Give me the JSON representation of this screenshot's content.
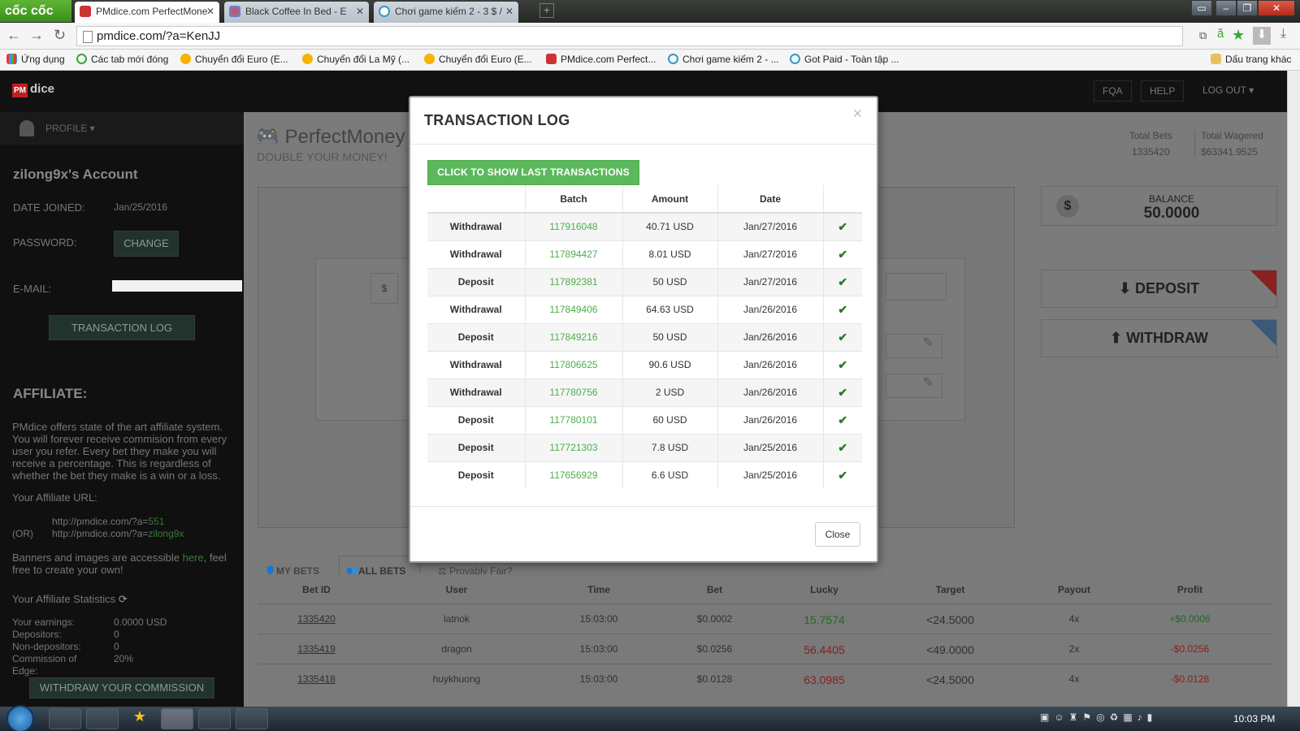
{
  "browser": {
    "brand": "cốc cốc",
    "tabs": [
      {
        "title": "PMdice.com PerfectMone",
        "active": true
      },
      {
        "title": "Black Coffee In Bed - E",
        "active": false
      },
      {
        "title": "Chơi game kiếm 2 - 3 $ / ",
        "active": false
      }
    ],
    "url": "pmdice.com/?a=KenJJ",
    "bookmarks": [
      "Ứng dụng",
      "Các tab mới đóng",
      "Chuyển đổi Euro (E...",
      "Chuyển đổi La Mỹ (...",
      "Chuyển đổi Euro (E...",
      "PMdice.com Perfect...",
      "Chơi game kiếm 2 - ...",
      "Got Paid - Toàn tập ..."
    ],
    "bookmarks_other": "Dấu trang khác"
  },
  "site": {
    "logo": "dice",
    "logo_badge": "PM",
    "nav": {
      "faq": "FQA",
      "help": "HELP",
      "logout": "LOG OUT ▾"
    }
  },
  "sidebar": {
    "profile": "PROFILE ▾",
    "account_title": "zilong9x's Account",
    "date_joined_label": "DATE JOINED:",
    "date_joined": "Jan/25/2016",
    "password_label": "PASSWORD:",
    "change_btn": "CHANGE",
    "email_label": "E-MAIL:",
    "transaction_log_btn": "TRANSACTION LOG",
    "affiliate_title": "AFFILIATE:",
    "affiliate_text": "PMdice offers state of the art affiliate system. You will forever receive commision from every user you refer. Every bet they make you will receive a percentage. This is regardless of whether the bet they make is a win or a loss.",
    "affiliate_url_label": "Your Affiliate URL:",
    "url1_prefix": "http://pmdice.com/?a=",
    "url1_code": "551",
    "or": "(OR)",
    "url2_prefix": "http://pmdice.com/?a=",
    "url2_code": "zilong9x",
    "banners_text": "Banners and images are accessible",
    "banners_link": "here",
    "banners_text2": ", feel free to create your own!",
    "stats_label": "Your Affiliate Statistics",
    "stats": [
      {
        "label": "Your earnings:",
        "value": "0.0000 USD"
      },
      {
        "label": "Depositors:",
        "value": "0"
      },
      {
        "label": "Non-depositors:",
        "value": "0"
      },
      {
        "label": "Commission of Edge:",
        "value": "20%"
      }
    ],
    "withdraw_commission_btn": "WITHDRAW YOUR COMMISSION"
  },
  "main": {
    "title": "PerfectMoney",
    "subtitle": "DOUBLE YOUR MONEY!",
    "total_bets_label": "Total Bets",
    "total_bets": "1335420",
    "total_wagered_label": "Total Wagered",
    "total_wagered": "$63341.9525",
    "balance_label": "BALANCE",
    "balance_value": "50.0000",
    "dollar": "$",
    "deposit_btn": "DEPOSIT",
    "withdraw_btn": "WITHDRAW",
    "tabs": [
      "MY BETS",
      "ALL BETS",
      "Provably Fair?"
    ],
    "bets_headers": [
      "Bet ID",
      "User",
      "Time",
      "Bet",
      "Lucky",
      "Target",
      "Payout",
      "Profit"
    ],
    "bets": [
      {
        "id": "1335420",
        "user": "latnok",
        "time": "15:03:00",
        "bet": "$0.0002",
        "lucky": "15.7574",
        "target": "<24.5000",
        "payout": "4x",
        "profit": "+$0.0006",
        "win": true
      },
      {
        "id": "1335419",
        "user": "dragon",
        "time": "15:03:00",
        "bet": "$0.0256",
        "lucky": "56.4405",
        "target": "<49.0000",
        "payout": "2x",
        "profit": "-$0.0256",
        "win": false
      },
      {
        "id": "1335418",
        "user": "huykhuong",
        "time": "15:03:00",
        "bet": "$0.0128",
        "lucky": "63.0985",
        "target": "<24.5000",
        "payout": "4x",
        "profit": "-$0.0128",
        "win": false
      }
    ]
  },
  "modal": {
    "title": "TRANSACTION LOG",
    "close_x": "×",
    "show_btn": "CLICK TO SHOW LAST TRANSACTIONS",
    "headers": [
      "",
      "Batch",
      "Amount",
      "Date",
      ""
    ],
    "rows": [
      {
        "type": "Withdrawal",
        "batch": "117916048",
        "amount": "40.71 USD",
        "date": "Jan/27/2016"
      },
      {
        "type": "Withdrawal",
        "batch": "117894427",
        "amount": "8.01 USD",
        "date": "Jan/27/2016"
      },
      {
        "type": "Deposit",
        "batch": "117892381",
        "amount": "50 USD",
        "date": "Jan/27/2016"
      },
      {
        "type": "Withdrawal",
        "batch": "117849406",
        "amount": "64.63 USD",
        "date": "Jan/26/2016"
      },
      {
        "type": "Deposit",
        "batch": "117849216",
        "amount": "50 USD",
        "date": "Jan/26/2016"
      },
      {
        "type": "Withdrawal",
        "batch": "117806625",
        "amount": "90.6 USD",
        "date": "Jan/26/2016"
      },
      {
        "type": "Withdrawal",
        "batch": "117780756",
        "amount": "2 USD",
        "date": "Jan/26/2016"
      },
      {
        "type": "Deposit",
        "batch": "117780101",
        "amount": "60 USD",
        "date": "Jan/26/2016"
      },
      {
        "type": "Deposit",
        "batch": "117721303",
        "amount": "7.8 USD",
        "date": "Jan/25/2016"
      },
      {
        "type": "Deposit",
        "batch": "117656929",
        "amount": "6.6 USD",
        "date": "Jan/25/2016"
      }
    ],
    "close_btn": "Close"
  },
  "taskbar": {
    "clock": "10:03 PM"
  },
  "colors": {
    "accent_green": "#5cb85c",
    "batch_green": "#4cae4c",
    "win": "#2e8b2e",
    "loss": "#c0392b"
  }
}
